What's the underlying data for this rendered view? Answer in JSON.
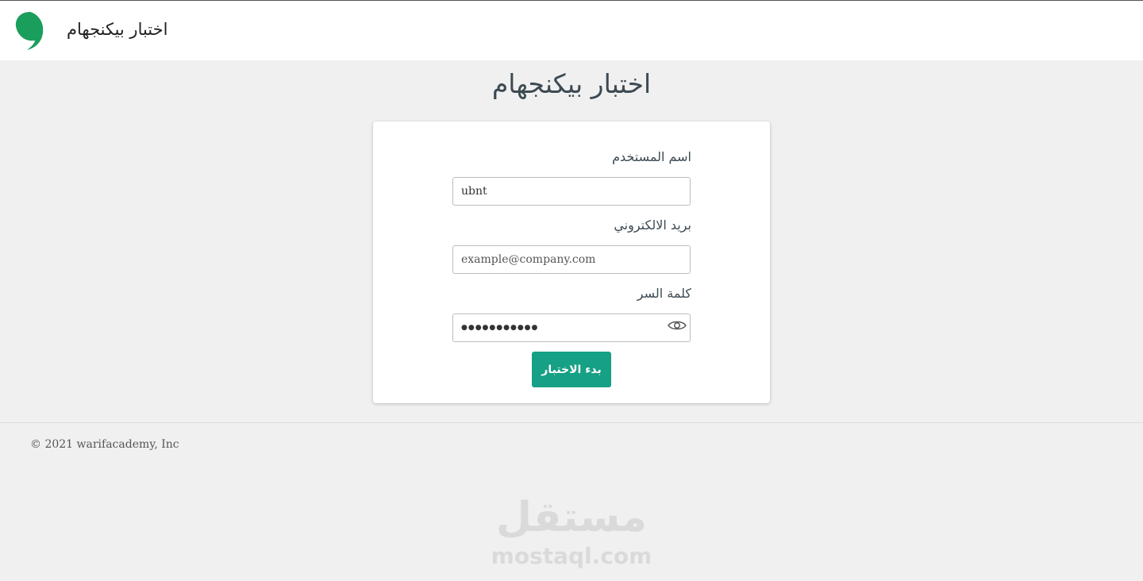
{
  "header": {
    "brand": "اختبار بيكنجهام",
    "logo_color": "#1a9e5c"
  },
  "page": {
    "title": "اختبار بيكنجهام"
  },
  "form": {
    "username_label": "اسم المستخدم",
    "username_value": "ubnt",
    "email_label": "بريد الالكتروني",
    "email_placeholder": "example@company.com",
    "password_label": "كلمة السر",
    "password_value": "●●●●●●●●●●●",
    "password_icon": "eye-icon",
    "submit_label": "بدء الاختبار",
    "accent_color": "#16a085"
  },
  "footer": {
    "copyright": "© 2021 warifacademy, Inc"
  },
  "watermark": {
    "arabic": "مستقل",
    "latin": "mostaql.com"
  }
}
